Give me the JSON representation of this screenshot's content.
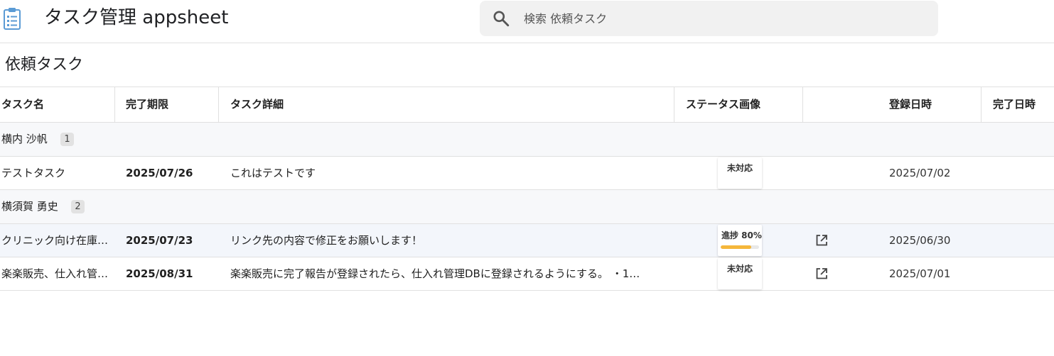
{
  "header": {
    "app_title": "タスク管理 appsheet",
    "app_icon": "clipboard-list-icon",
    "search_icon": "search-icon",
    "search_placeholder": "検索 依頼タスク"
  },
  "view": {
    "title": "依頼タスク"
  },
  "table": {
    "columns": [
      "タスク名",
      "完了期限",
      "タスク詳細",
      "ステータス画像",
      "",
      "登録日時",
      "完了日時"
    ],
    "groups": [
      {
        "name": "横内 沙帆",
        "count": "1",
        "rows": [
          {
            "name": "テストタスク",
            "due": "2025/07/26",
            "detail": "これはテストです",
            "status_label": "未対応",
            "has_link": false,
            "registered": "2025/07/02",
            "completed": ""
          }
        ]
      },
      {
        "name": "横須賀 勇史",
        "count": "2",
        "rows": [
          {
            "name": "クリニック向け在庫…",
            "due": "2025/07/23",
            "detail": "リンク先の内容で修正をお願いします！",
            "status_label": "進捗 80%",
            "progress": 0.8,
            "has_link": true,
            "registered": "2025/06/30",
            "completed": ""
          },
          {
            "name": "楽楽販売、仕入れ管…",
            "due": "2025/08/31",
            "detail": "楽楽販売に完了報告が登録されたら、仕入れ管理DBに登録されるようにする。 ・1…",
            "status_label": "未対応",
            "has_link": true,
            "registered": "2025/07/01",
            "completed": ""
          }
        ]
      }
    ]
  },
  "colors": {
    "progress_fill": "#f5b73b",
    "group_bg": "#f7f8fa",
    "highlight_row_bg": "#f3f6fb",
    "icon_blue": "#5b9bd5"
  }
}
